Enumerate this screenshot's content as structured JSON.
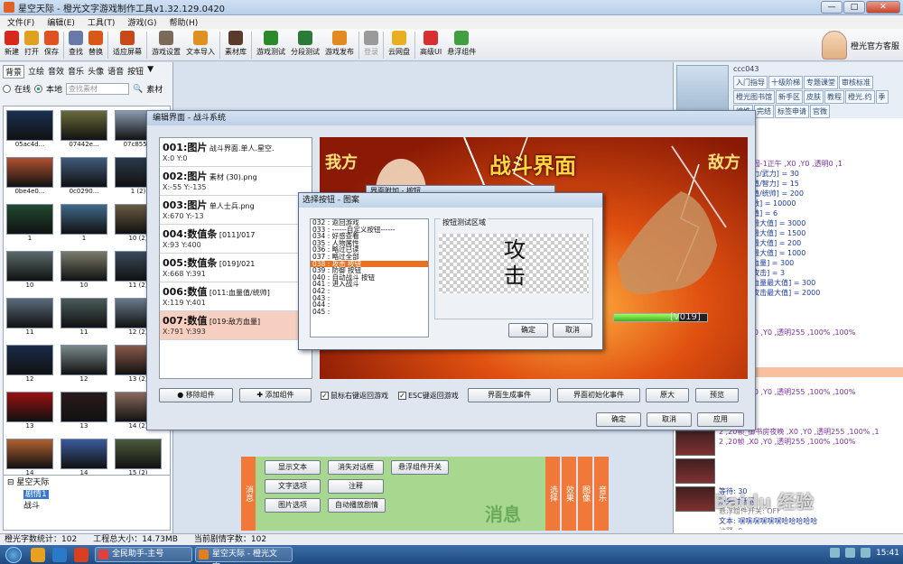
{
  "window": {
    "title": "星空天际 - 橙光文字游戏制作工具v1.32.129.0420",
    "controls": [
      "—",
      "□",
      "✕"
    ]
  },
  "menu": [
    "文件(F)",
    "编辑(E)",
    "工具(T)",
    "游戏(G)",
    "帮助(H)"
  ],
  "toolbar": {
    "items": [
      {
        "label": "新建",
        "icon": "new-icon",
        "color": "#d8281c"
      },
      {
        "label": "打开",
        "icon": "open-icon",
        "color": "#e0a020"
      },
      {
        "label": "保存",
        "icon": "save-icon",
        "color": "#e05020"
      },
      {
        "label": "查找",
        "icon": "find-icon",
        "color": "#6a7aa8"
      },
      {
        "label": "替换",
        "icon": "replace-icon",
        "color": "#d85818"
      },
      {
        "label": "适应屏幕",
        "icon": "fit-screen-icon",
        "color": "#c84818"
      },
      {
        "label": "游戏设置",
        "icon": "game-settings-icon",
        "color": "#7a6a5a"
      },
      {
        "label": "文本导入",
        "icon": "text-import-icon",
        "color": "#e09020"
      },
      {
        "label": "素材库",
        "icon": "asset-library-icon",
        "color": "#5a3a2a"
      },
      {
        "label": "游戏测试",
        "icon": "game-test-icon",
        "color": "#2a8a2a"
      },
      {
        "label": "分段测试",
        "icon": "segment-test-icon",
        "color": "#2a7a3a"
      },
      {
        "label": "游戏发布",
        "icon": "publish-icon",
        "color": "#e08a20"
      },
      {
        "label": "登录",
        "icon": "login-icon",
        "color": "#9a9a9a"
      },
      {
        "label": "云网盘",
        "icon": "cloud-disk-icon",
        "color": "#e8b020"
      },
      {
        "label": "高级UI",
        "icon": "advanced-ui-icon",
        "color": "#d83030"
      },
      {
        "label": "悬浮组件",
        "icon": "float-widget-icon",
        "color": "#40a040"
      }
    ],
    "official": "橙光官方客服"
  },
  "left": {
    "categories": [
      "背景",
      "立绘",
      "音效",
      "音乐",
      "头像",
      "语音",
      "按钮"
    ],
    "source_online": "在线",
    "source_local": "本地",
    "search_placeholder": "查找素材",
    "asset_label": "素材",
    "thumbs": [
      {
        "name": "05ac4d...",
        "color": "#1a3050"
      },
      {
        "name": "07442e...",
        "color": "#6a6a3a"
      },
      {
        "name": "07c855...",
        "color": "#8a9ab0"
      },
      {
        "name": "0be4e0...",
        "color": "#b05030"
      },
      {
        "name": "0c0290...",
        "color": "#405a7a"
      },
      {
        "name": "1 (2)",
        "color": "#2a3a4a"
      },
      {
        "name": "1",
        "color": "#204a30"
      },
      {
        "name": "1",
        "color": "#406a8a"
      },
      {
        "name": "10 (2)",
        "color": "#6a5a40"
      },
      {
        "name": "10",
        "color": "#5a6a6a"
      },
      {
        "name": "10",
        "color": "#7a7a6a"
      },
      {
        "name": "11 (2)",
        "color": "#3a4a5a"
      },
      {
        "name": "11",
        "color": "#5a6a7a"
      },
      {
        "name": "11",
        "color": "#4a5a5a"
      },
      {
        "name": "12 (2)",
        "color": "#6a7a8a"
      },
      {
        "name": "12",
        "color": "#1a2a4a"
      },
      {
        "name": "12",
        "color": "#7a8a8a"
      },
      {
        "name": "13 (2)",
        "color": "#8a5a4a"
      },
      {
        "name": "13",
        "color": "#9a1010"
      },
      {
        "name": "13",
        "color": "#2a1a1a"
      },
      {
        "name": "14 (2)",
        "color": "#8a6a5a"
      },
      {
        "name": "14",
        "color": "#b06030"
      },
      {
        "name": "14",
        "color": "#3a5a9a"
      },
      {
        "name": "15 (2)",
        "color": "#4a5a3a"
      }
    ],
    "tree": {
      "root": "星空天际",
      "child1": "剧情1",
      "child2": "战斗"
    }
  },
  "editor": {
    "title": "编辑界面 - 战斗系统",
    "components": [
      {
        "no": "001:",
        "type": "图片",
        "desc": "战斗界面.单人.星空.",
        "pos": "X:0  Y:0"
      },
      {
        "no": "002:",
        "type": "图片",
        "desc": "素材 (30).png",
        "pos": "X:-55  Y:-135"
      },
      {
        "no": "003:",
        "type": "图片",
        "desc": "单人士兵.png",
        "pos": "X:670  Y:-13"
      },
      {
        "no": "004:",
        "type": "数值条",
        "desc": "[011]/017",
        "pos": "X:93  Y:400"
      },
      {
        "no": "005:",
        "type": "数值条",
        "desc": "[019]/021",
        "pos": "X:668  Y:391"
      },
      {
        "no": "006:",
        "type": "数值",
        "desc": "[011:血量值/统帅]",
        "pos": "X:119  Y:401"
      },
      {
        "no": "007:",
        "type": "数值",
        "desc": "[019:敌方血量]",
        "pos": "X:791  Y:393"
      }
    ],
    "scene": {
      "left": "我方",
      "title": "战斗界面",
      "right": "敌方",
      "value": "[V019]"
    },
    "buttons": {
      "remove": "移除组件",
      "add": "添加组件",
      "right_click": "鼠标右键返回游戏",
      "esc": "ESC键返回游戏",
      "gen_event": "界面生成事件",
      "init_event": "界面初始化事件",
      "orig": "原大",
      "preview": "预览",
      "ok": "确定",
      "cancel": "取消",
      "apply": "应用"
    }
  },
  "dialog": {
    "title": "选择按钮 - 图案",
    "behind_title": "界面附加 - 按钮",
    "list": [
      "032 : 返回游戏",
      "033 : ------自定义按钮------",
      "034 : 好感查看",
      "035 : 人物属性",
      "036 : 略过已读",
      "037 : 略过全部",
      "038 : 攻击 按钮",
      "039 : 防御 按钮",
      "040 : 自动战斗 按钮",
      "041 : 进入战斗",
      "042 :",
      "043 :",
      "044 :",
      "045 :"
    ],
    "selected_index": 6,
    "preview_caption": "按钮测试区域",
    "preview_text_1": "攻",
    "preview_text_2": "击",
    "ok": "确定",
    "cancel": "取消"
  },
  "right": {
    "nick": "ccc043",
    "links": [
      "入门指导",
      "十级阶梯",
      "专题课堂",
      "审核标准",
      "橙光图书馆",
      "新手区",
      "皮肤",
      "教程",
      "橙光.约",
      "季",
      "编推",
      "完结",
      "标签申请",
      "官微"
    ],
    "lines": [
      {
        "t": "-N-T |",
        "c": "blue"
      },
      {
        "t": "开关: ON",
        "c": "grey"
      },
      {
        "t": "-E-T | 002",
        "c": "blue"
      },
      {
        "t": "开关: OFF",
        "c": "grey"
      },
      {
        "t": ",540_御花园-1正午 ,X0 ,Y0 ,透明0 ,1",
        "c": "purple"
      },
      {
        "t": "[009:攻击力/武力] = 30",
        "c": "blue"
      },
      {
        "t": "[010:防御值/智力] = 15",
        "c": "blue"
      },
      {
        "t": "[011:血量值/统帅] = 200",
        "c": "blue"
      },
      {
        "t": "[012:金钱数] = 10000",
        "c": "blue"
      },
      {
        "t": "[013:幸运值] = 6",
        "c": "blue"
      },
      {
        "t": "[015:攻击最大值] = 3000",
        "c": "blue"
      },
      {
        "t": "[016:防御最大值] = 1500",
        "c": "blue"
      },
      {
        "t": "[017:血量最大值] = 200",
        "c": "blue"
      },
      {
        "t": "[018:精力最大值] = 1000",
        "c": "blue"
      },
      {
        "t": "[019:敌方血量] = 300",
        "c": "blue"
      },
      {
        "t": "[020:敌方攻击] = 3",
        "c": "blue"
      },
      {
        "t": "[021:敌方血量最大值] = 300",
        "c": "blue"
      },
      {
        "t": "[022:敌方攻击最大值] = 2000",
        "c": "blue"
      },
      {
        "t": "",
        "c": "grey"
      },
      {
        "t": "上",
        "c": "grey"
      },
      {
        "t": "开关: OFF",
        "c": "grey"
      },
      {
        "t": "2 ,20帧 ,X0 ,Y0 ,透明255 ,100% ,100%",
        "c": "purple"
      },
      {
        "t": "",
        "c": "grey"
      },
      {
        "t": "",
        "c": "grey"
      },
      {
        "t": "结",
        "c": "grey"
      },
      {
        "t": "剧情",
        "c": "hl"
      },
      {
        "t": "-E-T | 003",
        "c": "blue"
      },
      {
        "t": "2 ,20帧 ,X0 ,Y0 ,透明255 ,100% ,100%",
        "c": "purple"
      },
      {
        "t": "",
        "c": "grey"
      },
      {
        "t": "",
        "c": "grey"
      },
      {
        "t": "开关: OFF",
        "c": "grey"
      },
      {
        "t": "2 ,20帧_御书房夜晚 ,X0 ,Y0 ,透明255 ,100% ,1",
        "c": "purple"
      },
      {
        "t": "2 ,20帧 ,X0 ,Y0 ,透明255 ,100% ,100%",
        "c": "purple"
      },
      {
        "t": "",
        "c": "grey"
      },
      {
        "t": "",
        "c": "grey"
      },
      {
        "t": "",
        "c": "grey"
      },
      {
        "t": "",
        "c": "grey"
      },
      {
        "t": "等待: 30",
        "c": "blue"
      },
      {
        "t": "消失对话框",
        "c": "blue"
      },
      {
        "t": "悬浮组件开关: OFF",
        "c": "grey"
      },
      {
        "t": "文本: 嘿嘿嘿嘿嘿嘿哈哈哈哈哈",
        "c": "blue"
      },
      {
        "t": "注释: 0",
        "c": "grey"
      },
      {
        "t": "文本: -E-T | 04",
        "c": "blue"
      },
      {
        "t": "",
        "c": "grey"
      },
      {
        "t": "背景图: 2 ,540_白天 ,X0 ,Y0 ,透明255 ,100% ,100%",
        "c": "purple"
      },
      {
        "t": "2 ,20帧 ,X0 ,Y0 ,透明255 ,100% ,100%",
        "c": "purple"
      }
    ]
  },
  "bottom": {
    "msg_tab": "消息",
    "buttons": [
      "显示文本",
      "消失对话框",
      "悬浮组件开关",
      "文字选项",
      "注释",
      "图片选项",
      "自动播放剧情"
    ],
    "watermark": "消息",
    "tabs": [
      "选择",
      "效果",
      "图像",
      "音乐"
    ]
  },
  "status": {
    "chars": "橙光字数统计：102",
    "size": "工程总大小：14.73MB",
    "current": "当前剧情字数：102"
  },
  "taskbar": {
    "task1": "全民助手-主号",
    "task2": "星空天际 - 橙光文字...",
    "clock": "15:41",
    "brand": "Baidu 经验",
    "url": "jingyan.baidu.com"
  }
}
